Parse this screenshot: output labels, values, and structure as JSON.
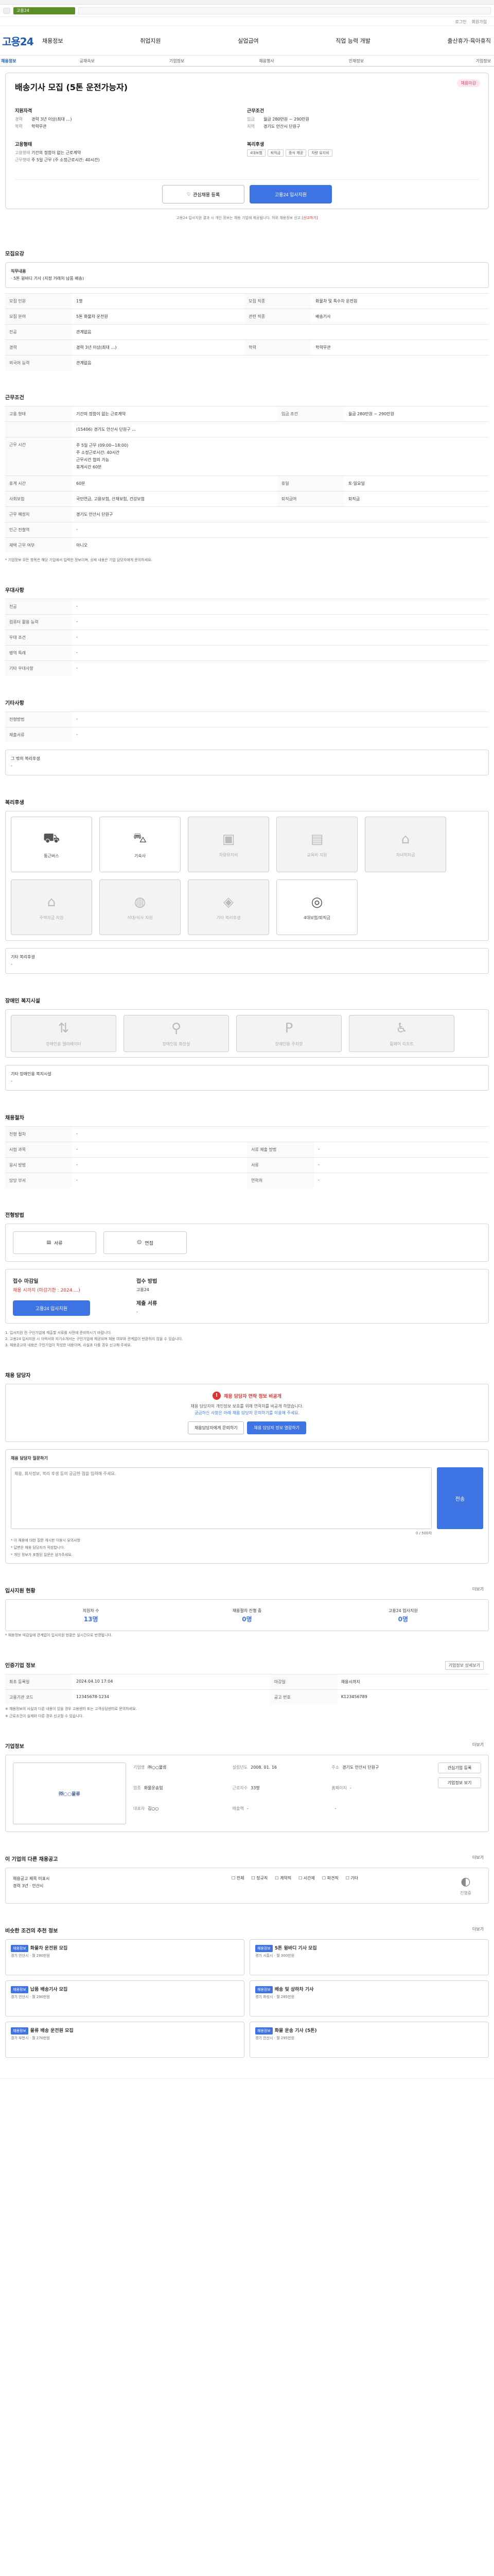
{
  "browser": {
    "tab_label": "고용24"
  },
  "toplinks": [
    "로그인",
    "회원가입"
  ],
  "logo": "고용24",
  "nav": [
    "채용정보",
    "취업지원",
    "실업급여",
    "직업 능력 개발",
    "출산휴가·육아휴직"
  ],
  "subnav": [
    "채용정보",
    "공채속보",
    "기업정보",
    "채용행사",
    "인재정보",
    "기업정보"
  ],
  "job": {
    "title": "배송기사 모집 (5톤 운전가능자)",
    "badge": "채용마감",
    "left_label": "지원자격",
    "left_rows": [
      [
        "경력",
        "경력 3년 이상(최대 …)"
      ],
      [
        "학력",
        "학력무관"
      ]
    ],
    "mid_label": "고용형태",
    "mid_rows": [
      [
        "고용형태",
        "기간의 정함이 없는 근로계약"
      ],
      [
        "근무형태",
        "주 5일 근무 (주 소정근로시간: 40시간)"
      ]
    ],
    "right_label": "근무조건",
    "right_rows": [
      [
        "임금",
        "월급 280만원 ~ 290만원"
      ],
      [
        "지역",
        "경기도 안산시 단원구"
      ]
    ],
    "right_label2": "복리후생",
    "tags": [
      "4대보험",
      "퇴직금",
      "중식 제공",
      "차량 유지비"
    ],
    "btn_save": "관심채용 등록",
    "btn_apply": "고용24 입사지원",
    "notice": "고용24 입사지원 결과 시 개인 정보는 채용 기업에 제공됩니다. 허위 채용정보 신고",
    "notice_red": "[신고하기]"
  },
  "recruit": {
    "title": "모집요강",
    "sub_title": "직무내용",
    "sub_text": "· 5톤 윙바디 기사 (지정 거래처 납품 배송)",
    "rows": [
      [
        "모집 인원",
        "1명",
        "모집 직종",
        "화물차 및 특수차 운전원"
      ],
      [
        "모집 분야",
        "5톤 화물차 운전원",
        "관련 직종",
        "배송기사"
      ],
      [
        "전공",
        "관계없음",
        "",
        ""
      ],
      [
        "경력",
        "경력 3년 이상(최대 …)",
        "학력",
        "학력무관"
      ],
      [
        "외국어 능력",
        "관계없음",
        "",
        ""
      ]
    ]
  },
  "condition": {
    "title": "근무조건",
    "rows1": [
      [
        "고용 형태",
        "기간의 정함이 없는 근로계약",
        "임금 조건",
        "월급 280만원 ~ 290만원"
      ]
    ],
    "addr": "(15406) 경기도 안산시 단원구 ...",
    "hours_title": "근무 시간",
    "hours": [
      "주 5일 근무 (09:00~18:00)",
      "주 소정근로시간: 40시간",
      "근무시간 협의 가능",
      "휴게시간 60분"
    ],
    "rows2": [
      [
        "휴게 시간",
        "60분",
        "휴일",
        "토·일요일"
      ],
      [
        "사회보험",
        "국민연금, 고용보험, 산재보험, 건강보험",
        "퇴직급여",
        "퇴직금"
      ],
      [
        "근무 예정지",
        "경기도 안산시 단원구",
        "",
        ""
      ],
      [
        "인근 전철역",
        "-",
        "",
        ""
      ],
      [
        "재택 근무 여부",
        "아니오",
        "",
        ""
      ]
    ],
    "note": "* 기업정보 모든 항목은 해당 기업에서 입력한 정보이며, 상세 내용은 기업 담당자에게 문의하세요."
  },
  "etc": {
    "title": "우대사항",
    "rows": [
      [
        "전공",
        "-"
      ],
      [
        "컴퓨터 활용 능력",
        "-"
      ],
      [
        "우대 조건",
        "-"
      ],
      [
        "병역 특례",
        "-"
      ],
      [
        "기타 우대사항",
        "-"
      ]
    ]
  },
  "more": {
    "title": "기타사항",
    "rows": [
      [
        "전형방법",
        "-"
      ],
      [
        "제출서류",
        "-"
      ]
    ],
    "fee_title": "그 밖의 복리후생",
    "fee_val": "-"
  },
  "welfare": {
    "title": "복리후생",
    "items": [
      {
        "label": "통근버스",
        "dis": false,
        "icon": "bus-icon",
        "glyph": "⛟"
      },
      {
        "label": "기숙사",
        "dis": false,
        "icon": "car-icon",
        "glyph": "⛍"
      },
      {
        "label": "차량유지비",
        "dis": true,
        "icon": "parking-icon",
        "glyph": "▣"
      },
      {
        "label": "교육비 지원",
        "dis": true,
        "icon": "book-icon",
        "glyph": "▤"
      },
      {
        "label": "자녀학자금",
        "dis": true,
        "icon": "school-icon",
        "glyph": "⌂"
      },
      {
        "label": "주택자금 지원",
        "dis": true,
        "icon": "house-icon",
        "glyph": "⌂"
      },
      {
        "label": "식대/식사 지원",
        "dis": true,
        "icon": "meal-icon",
        "glyph": "◍"
      },
      {
        "label": "기타 복리후생",
        "dis": true,
        "icon": "gift-icon",
        "glyph": "◈"
      },
      {
        "label": "4대보험/퇴직금",
        "dis": false,
        "icon": "shield-icon",
        "glyph": "◎"
      }
    ],
    "extra_label": "기타 복리후생",
    "extra_val": "-"
  },
  "disabled": {
    "title": "장애인 복지시설",
    "items": [
      "장애인용 엘리베이터",
      "장애인용 화장실",
      "장애인용 주차장",
      "휠체어 리프트"
    ],
    "extra_label": "기타 장애인용 복지시설",
    "extra_val": "-"
  },
  "process": {
    "title": "채용절차",
    "rows": [
      [
        "전형 절차",
        "-",
        "",
        ""
      ],
      [
        "시험 과목",
        "-",
        "서류 제출 방법",
        "-"
      ],
      [
        "응시 방법",
        "-",
        "서류",
        "-"
      ],
      [
        "담당 부서",
        "-",
        "연락처",
        "-"
      ]
    ]
  },
  "method": {
    "title": "전형방법",
    "btns": [
      "서류",
      "면접"
    ],
    "period_label": "접수 마감일",
    "period_val": "채용 시까지 (마감기한 : 2024.…)",
    "method_label": "접수 방법",
    "method_val": "고용24",
    "submit_label": "제출 서류",
    "submit_val": "-",
    "apply_btn": "고용24 입사지원",
    "notes": [
      "1. 입사지원 전 구인기업에 제출할 서류를 사전에 준비하시기 바랍니다.",
      "2. 고용24 입사지원 시 이력서와 자기소개서는 구인기업에 제공되며 채용 여부와 관계없이 반환하지 않을 수 있습니다.",
      "3. 채용공고의 내용은 구인기업이 작성한 내용이며, 사실과 다를 경우 신고해 주세요."
    ]
  },
  "contact": {
    "title": "채용 담당자",
    "hidden_head": "채용 담당자 연락 정보 비공개",
    "hidden_text": "채용 담당자의 개인정보 보호를 위해 연락처를 비공개 하였습니다.",
    "hidden_text2": "궁금하신 사항은 아래 채용 담당자 문의하기를 이용해 주세요.",
    "btn1": "채용담당자에게 문의하기",
    "btn2": "채용 담당자 정보 열람하기",
    "q_label": "채용 담당자 질문하기",
    "placeholder": "채용, 회사정보, 복리 후생 등의 궁금한 점을 입력해 주세요.",
    "counter": "0 / 500자",
    "send": "전송",
    "q_notes": [
      "* 이 채용에 대한 질문 게시판 이용시 유의사항",
      "* 답변은 채용 담당자가 작성합니다.",
      "* 개인 정보가 포함된 질문은 삼가주세요."
    ]
  },
  "status": {
    "title": "입사지원 현황",
    "more": "더보기",
    "items": [
      [
        "지원자 수",
        "13명"
      ],
      [
        "채용절차 진행 중",
        "0명"
      ],
      [
        "고용24 입사지원",
        "0명"
      ]
    ],
    "note": "* 채용정보 마감일에 관계없이 입사지원 현황은 실시간으로 반영됩니다."
  },
  "reg": {
    "title": "인증기업 정보",
    "btn": "기업정보 상세보기",
    "rows": [
      [
        "최초 등록일",
        "2024.04.10 17:04",
        "마감일",
        "채용시까지"
      ],
      [
        "고용기관 코드",
        "12345678-1234",
        "공고 번호",
        "K123456789"
      ]
    ],
    "notes": [
      "※ 채용정보의 사실과 다른 내용이 있을 경우 고용센터 또는 고객상담센터로 문의하세요.",
      "※ 근로조건이 실제와 다른 경우 신고할 수 있습니다."
    ]
  },
  "company": {
    "title": "기업정보",
    "more": "더보기",
    "name": "㈜○○물류",
    "rows": [
      [
        "기업명",
        "㈜○○물류"
      ],
      [
        "업종",
        "화물운송업"
      ],
      [
        "대표자",
        "김○○"
      ],
      [
        "설립년도",
        "2008. 01. 16"
      ],
      [
        "근로자수",
        "33명"
      ],
      [
        "매출액",
        "-"
      ],
      [
        "주소",
        "경기도 안산시 단원구"
      ],
      [
        "홈페이지",
        "-"
      ],
      [
        "",
        "-"
      ]
    ],
    "btn1": "관심기업 등록",
    "btn2": "기업정보 보기"
  },
  "other": {
    "title": "이 기업의 다른 채용공고",
    "more": "더보기",
    "text1": "채용공고 제목 미표시",
    "text2": "경력 3년 · 안산시",
    "checks": [
      "전체",
      "정규직",
      "계약직",
      "시간제",
      "파견직",
      "기타"
    ],
    "side": "진행중"
  },
  "similar": {
    "title": "비슷한 조건의 추천 정보",
    "more": "더보기",
    "items": [
      {
        "tag": "채용정보",
        "t": "화물차 운전원 모집",
        "s": "경기 안산시 · 월 280만원"
      },
      {
        "tag": "채용정보",
        "t": "5톤 윙바디 기사 모집",
        "s": "경기 시흥시 · 월 300만원"
      },
      {
        "tag": "채용정보",
        "t": "납품 배송기사 모집",
        "s": "경기 안산시 · 월 290만원"
      },
      {
        "tag": "채용정보",
        "t": "배송 및 상하차 기사",
        "s": "경기 화성시 · 월 285만원"
      },
      {
        "tag": "채용정보",
        "t": "물류 배송 운전원 모집",
        "s": "경기 부천시 · 월 270만원"
      },
      {
        "tag": "채용정보",
        "t": "화물 운송 기사 (5톤)",
        "s": "경기 안산시 · 월 295만원"
      }
    ]
  }
}
